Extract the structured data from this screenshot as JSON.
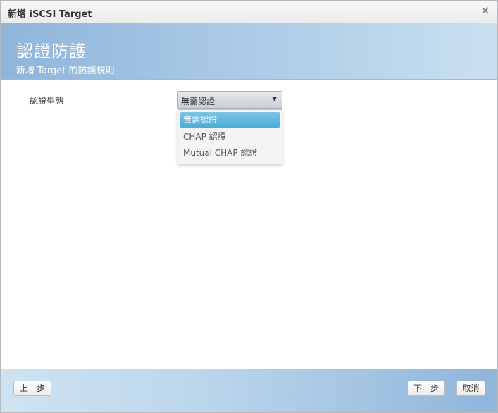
{
  "window": {
    "title": "新增 iSCSI Target",
    "close_glyph": "×"
  },
  "banner": {
    "heading": "認證防護",
    "subheading": "新增 Target 的防護規則"
  },
  "form": {
    "auth_type_label": "認證型態",
    "auth_type_select": {
      "value": "無需認證",
      "arrow_glyph": "▼",
      "options": [
        "無需認證",
        "CHAP 認證",
        "Mutual CHAP 認證"
      ],
      "selected_index": 0
    }
  },
  "footer": {
    "prev_label": "上一步",
    "next_label": "下一步",
    "cancel_label": "取消"
  }
}
